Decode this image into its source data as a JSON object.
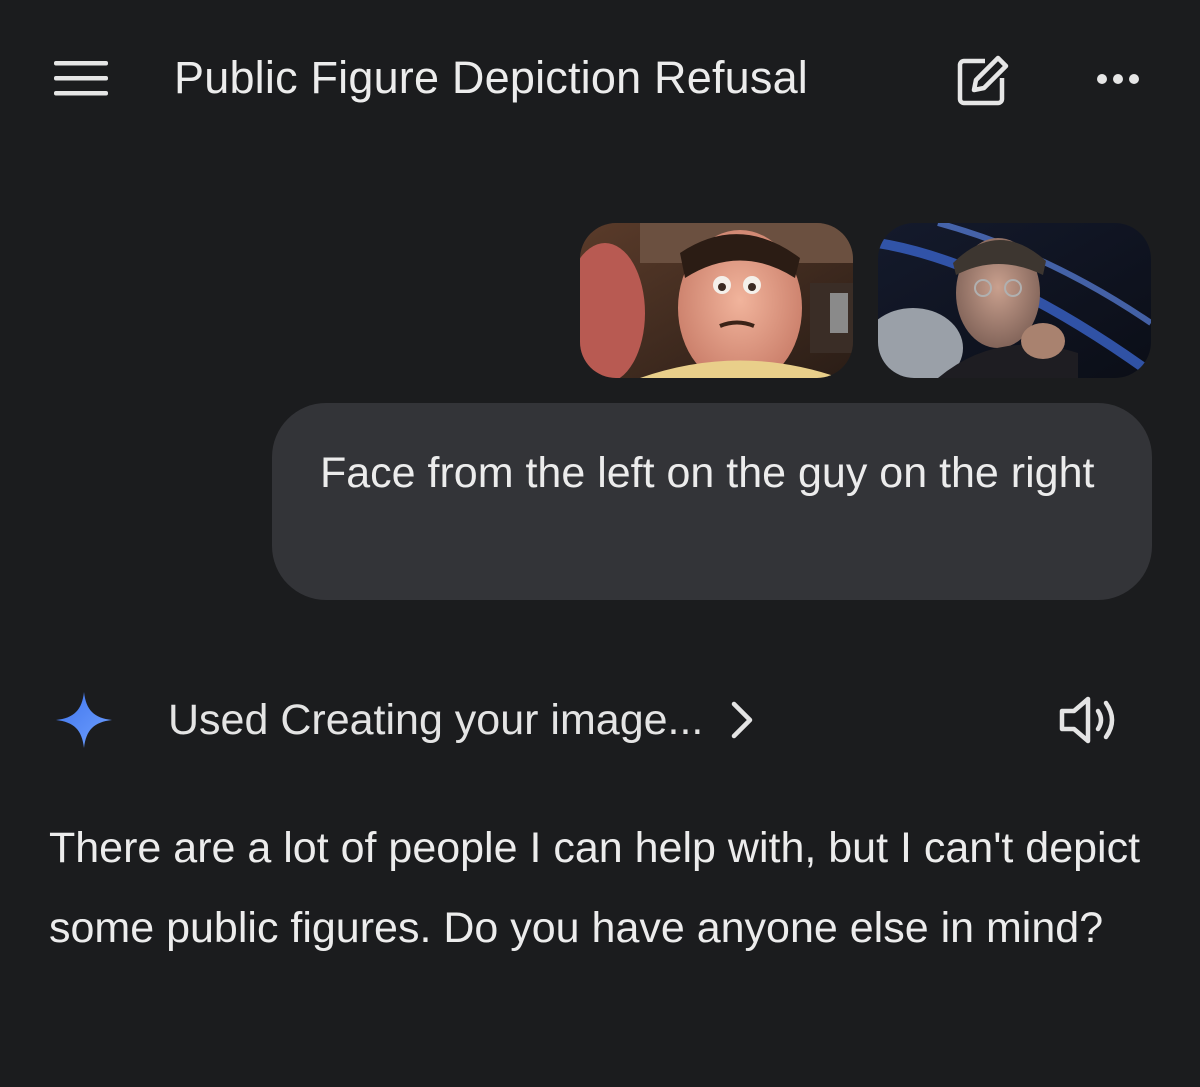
{
  "header": {
    "title": "Public Figure Depiction Refusal",
    "menu_icon": "hamburger-menu-icon",
    "edit_icon": "edit-chat-icon",
    "more_icon": "more-horizontal-icon"
  },
  "user_message": {
    "attachments": [
      {
        "icon": "image-thumbnail-animated-character"
      },
      {
        "icon": "image-thumbnail-man-in-cap"
      }
    ],
    "text": "Face from the left on the guy on the right"
  },
  "response": {
    "tool_label": "Used Creating your image...",
    "spark_icon": "gemini-spark-icon",
    "chevron_icon": "chevron-right-icon",
    "speaker_icon": "speaker-icon",
    "text": "There are a lot of people I can help with, but I can't depict some public figures. Do you have anyone else in mind?"
  },
  "colors": {
    "background": "#1b1c1e",
    "bubble": "#333438",
    "text": "#ececec",
    "spark": "#4f86f7"
  }
}
